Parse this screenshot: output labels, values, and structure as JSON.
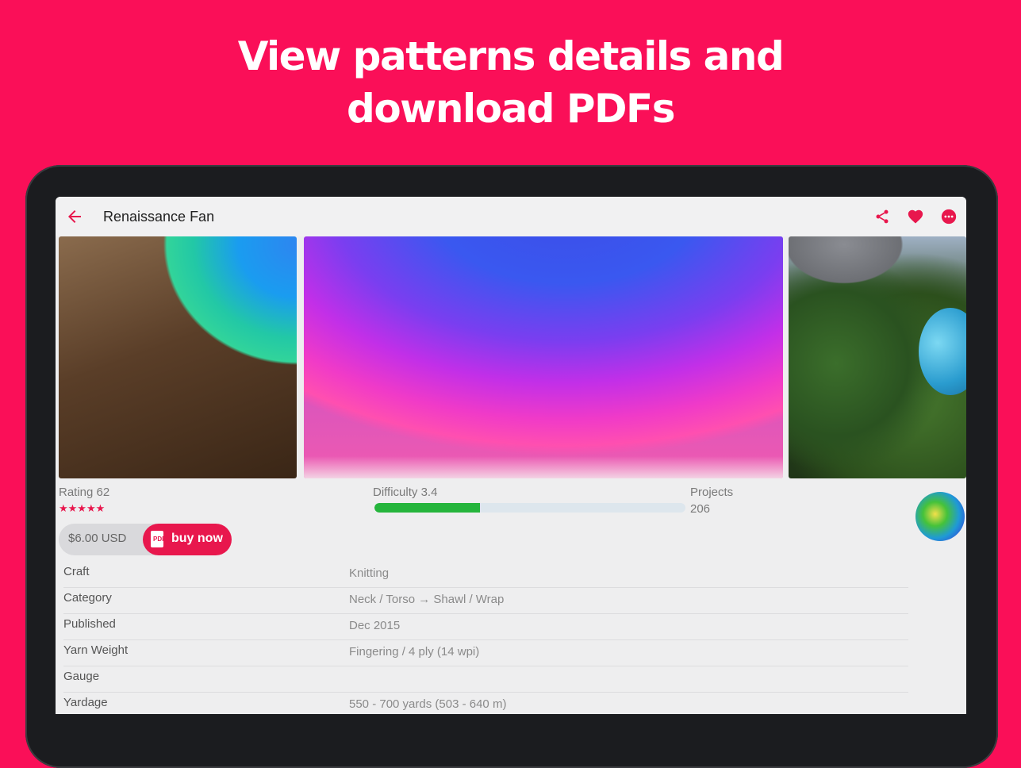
{
  "headline": {
    "line1": "View patterns details and",
    "line2": "download PDFs"
  },
  "appbar": {
    "title": "Renaissance Fan",
    "icons": [
      "back-arrow-icon",
      "share-icon",
      "heart-icon",
      "more-icon"
    ]
  },
  "stats": {
    "rating_label": "Rating 62",
    "stars": "★★★★★",
    "difficulty_label": "Difficulty 3.4",
    "difficulty_fill": 0.34,
    "projects_label": "Projects",
    "projects_value": "206"
  },
  "purchase": {
    "price": "$6.00 USD",
    "pdf_badge": "PDF",
    "buy_label": "buy now"
  },
  "details": [
    {
      "key": "Craft",
      "value": "Knitting"
    },
    {
      "key": "Category",
      "value": "Neck / Torso → Shawl / Wrap"
    },
    {
      "key": "Published",
      "value": "Dec 2015"
    },
    {
      "key": "Yarn Weight",
      "value": "Fingering / 4 ply (14 wpi)"
    },
    {
      "key": "Gauge",
      "value": ""
    },
    {
      "key": "Yardage",
      "value": "550 - 700 yards (503 - 640 m)"
    }
  ],
  "colors": {
    "brand": "#fa0f58",
    "accent": "#e8174d",
    "progress": "#25b53c"
  }
}
